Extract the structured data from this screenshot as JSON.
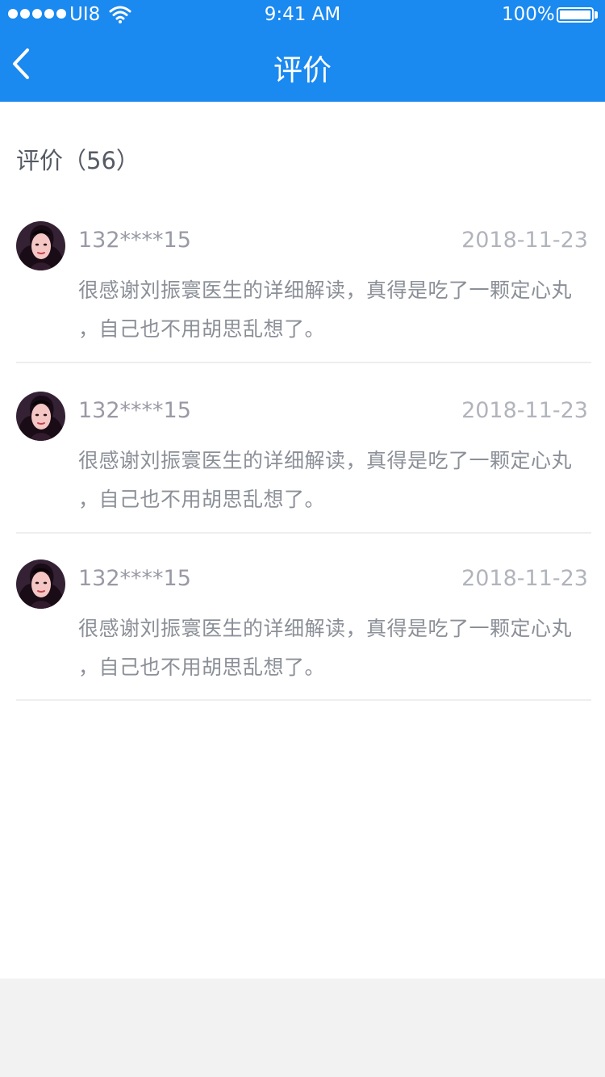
{
  "status_bar": {
    "carrier": "UI8",
    "time": "9:41 AM",
    "battery": "100%"
  },
  "nav": {
    "title": "评价"
  },
  "reviews_section": {
    "label": "评价",
    "count": "（56）"
  },
  "reviews": [
    {
      "user": "132****15",
      "date": "2018-11-23",
      "text": "很感谢刘振寰医生的详细解读，真得是吃了一颗定心丸\n，自己也不用胡思乱想了。"
    },
    {
      "user": "132****15",
      "date": "2018-11-23",
      "text": "很感谢刘振寰医生的详细解读，真得是吃了一颗定心丸\n，自己也不用胡思乱想了。"
    },
    {
      "user": "132****15",
      "date": "2018-11-23",
      "text": "很感谢刘振寰医生的详细解读，真得是吃了一颗定心丸\n，自己也不用胡思乱想了。"
    }
  ],
  "colors": {
    "header": "#1a89f0",
    "background": "#f2f2f2",
    "text_primary": "#555a64",
    "text_secondary": "#999aa5"
  },
  "icons": {
    "back": "chevron-left-icon",
    "wifi": "wifi-icon",
    "battery": "battery-icon"
  }
}
